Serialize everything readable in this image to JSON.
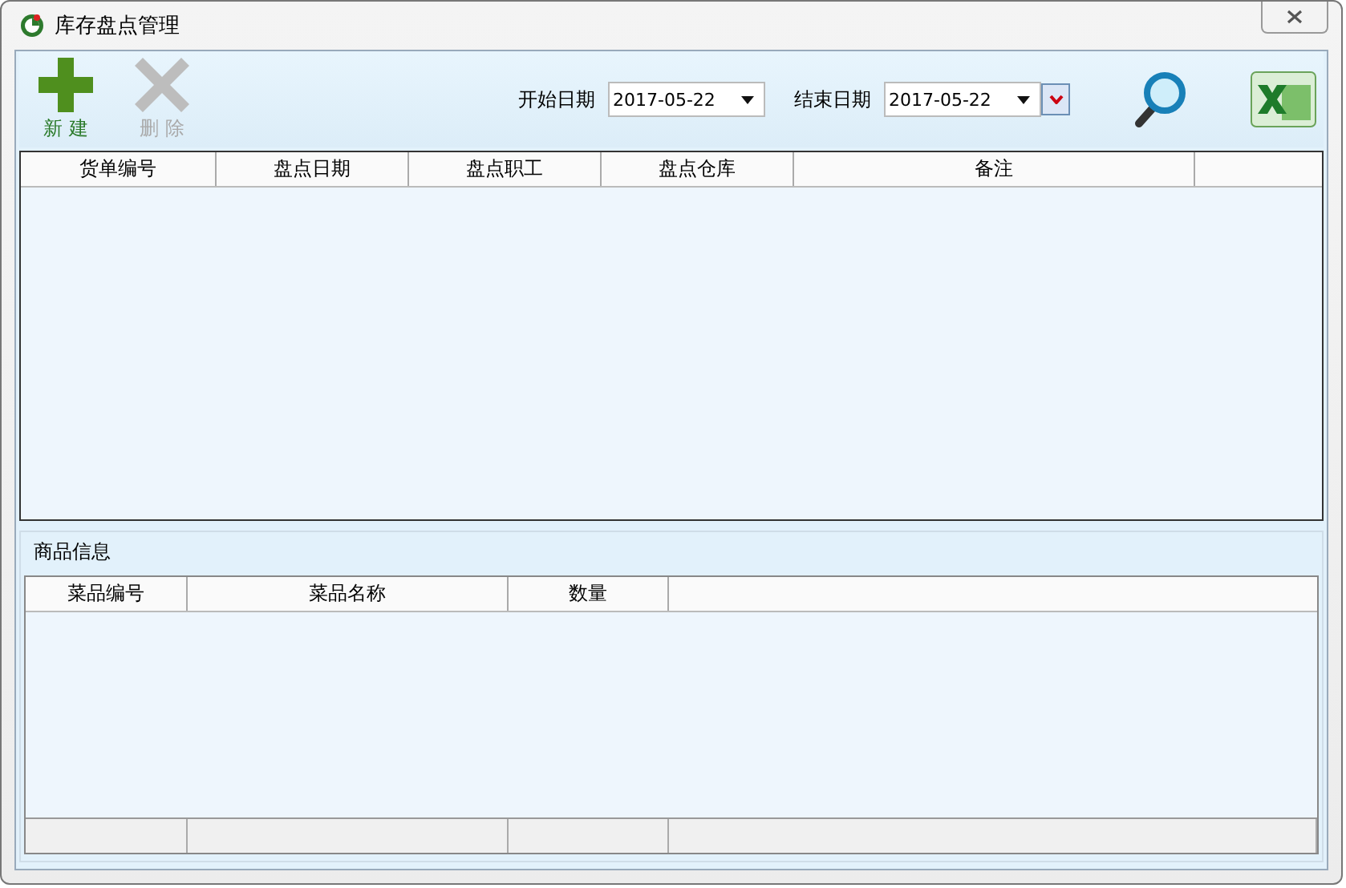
{
  "window": {
    "title": "库存盘点管理"
  },
  "toolbar": {
    "buttons": [
      {
        "kind": "add",
        "label": "新 建",
        "disabled": false
      },
      {
        "kind": "delete",
        "label": "删 除",
        "disabled": true
      }
    ]
  },
  "filters": [
    {
      "label": "开始日期",
      "value": "2017-05-22"
    },
    {
      "label": "结束日期",
      "value": "2017-05-22"
    }
  ],
  "orders_table": {
    "columns": [
      "货单编号",
      "盘点日期",
      "盘点职工",
      "盘点仓库",
      "备注"
    ]
  },
  "goods_section": {
    "title": "商品信息",
    "columns": [
      "菜品编号",
      "菜品名称",
      "数量"
    ]
  }
}
